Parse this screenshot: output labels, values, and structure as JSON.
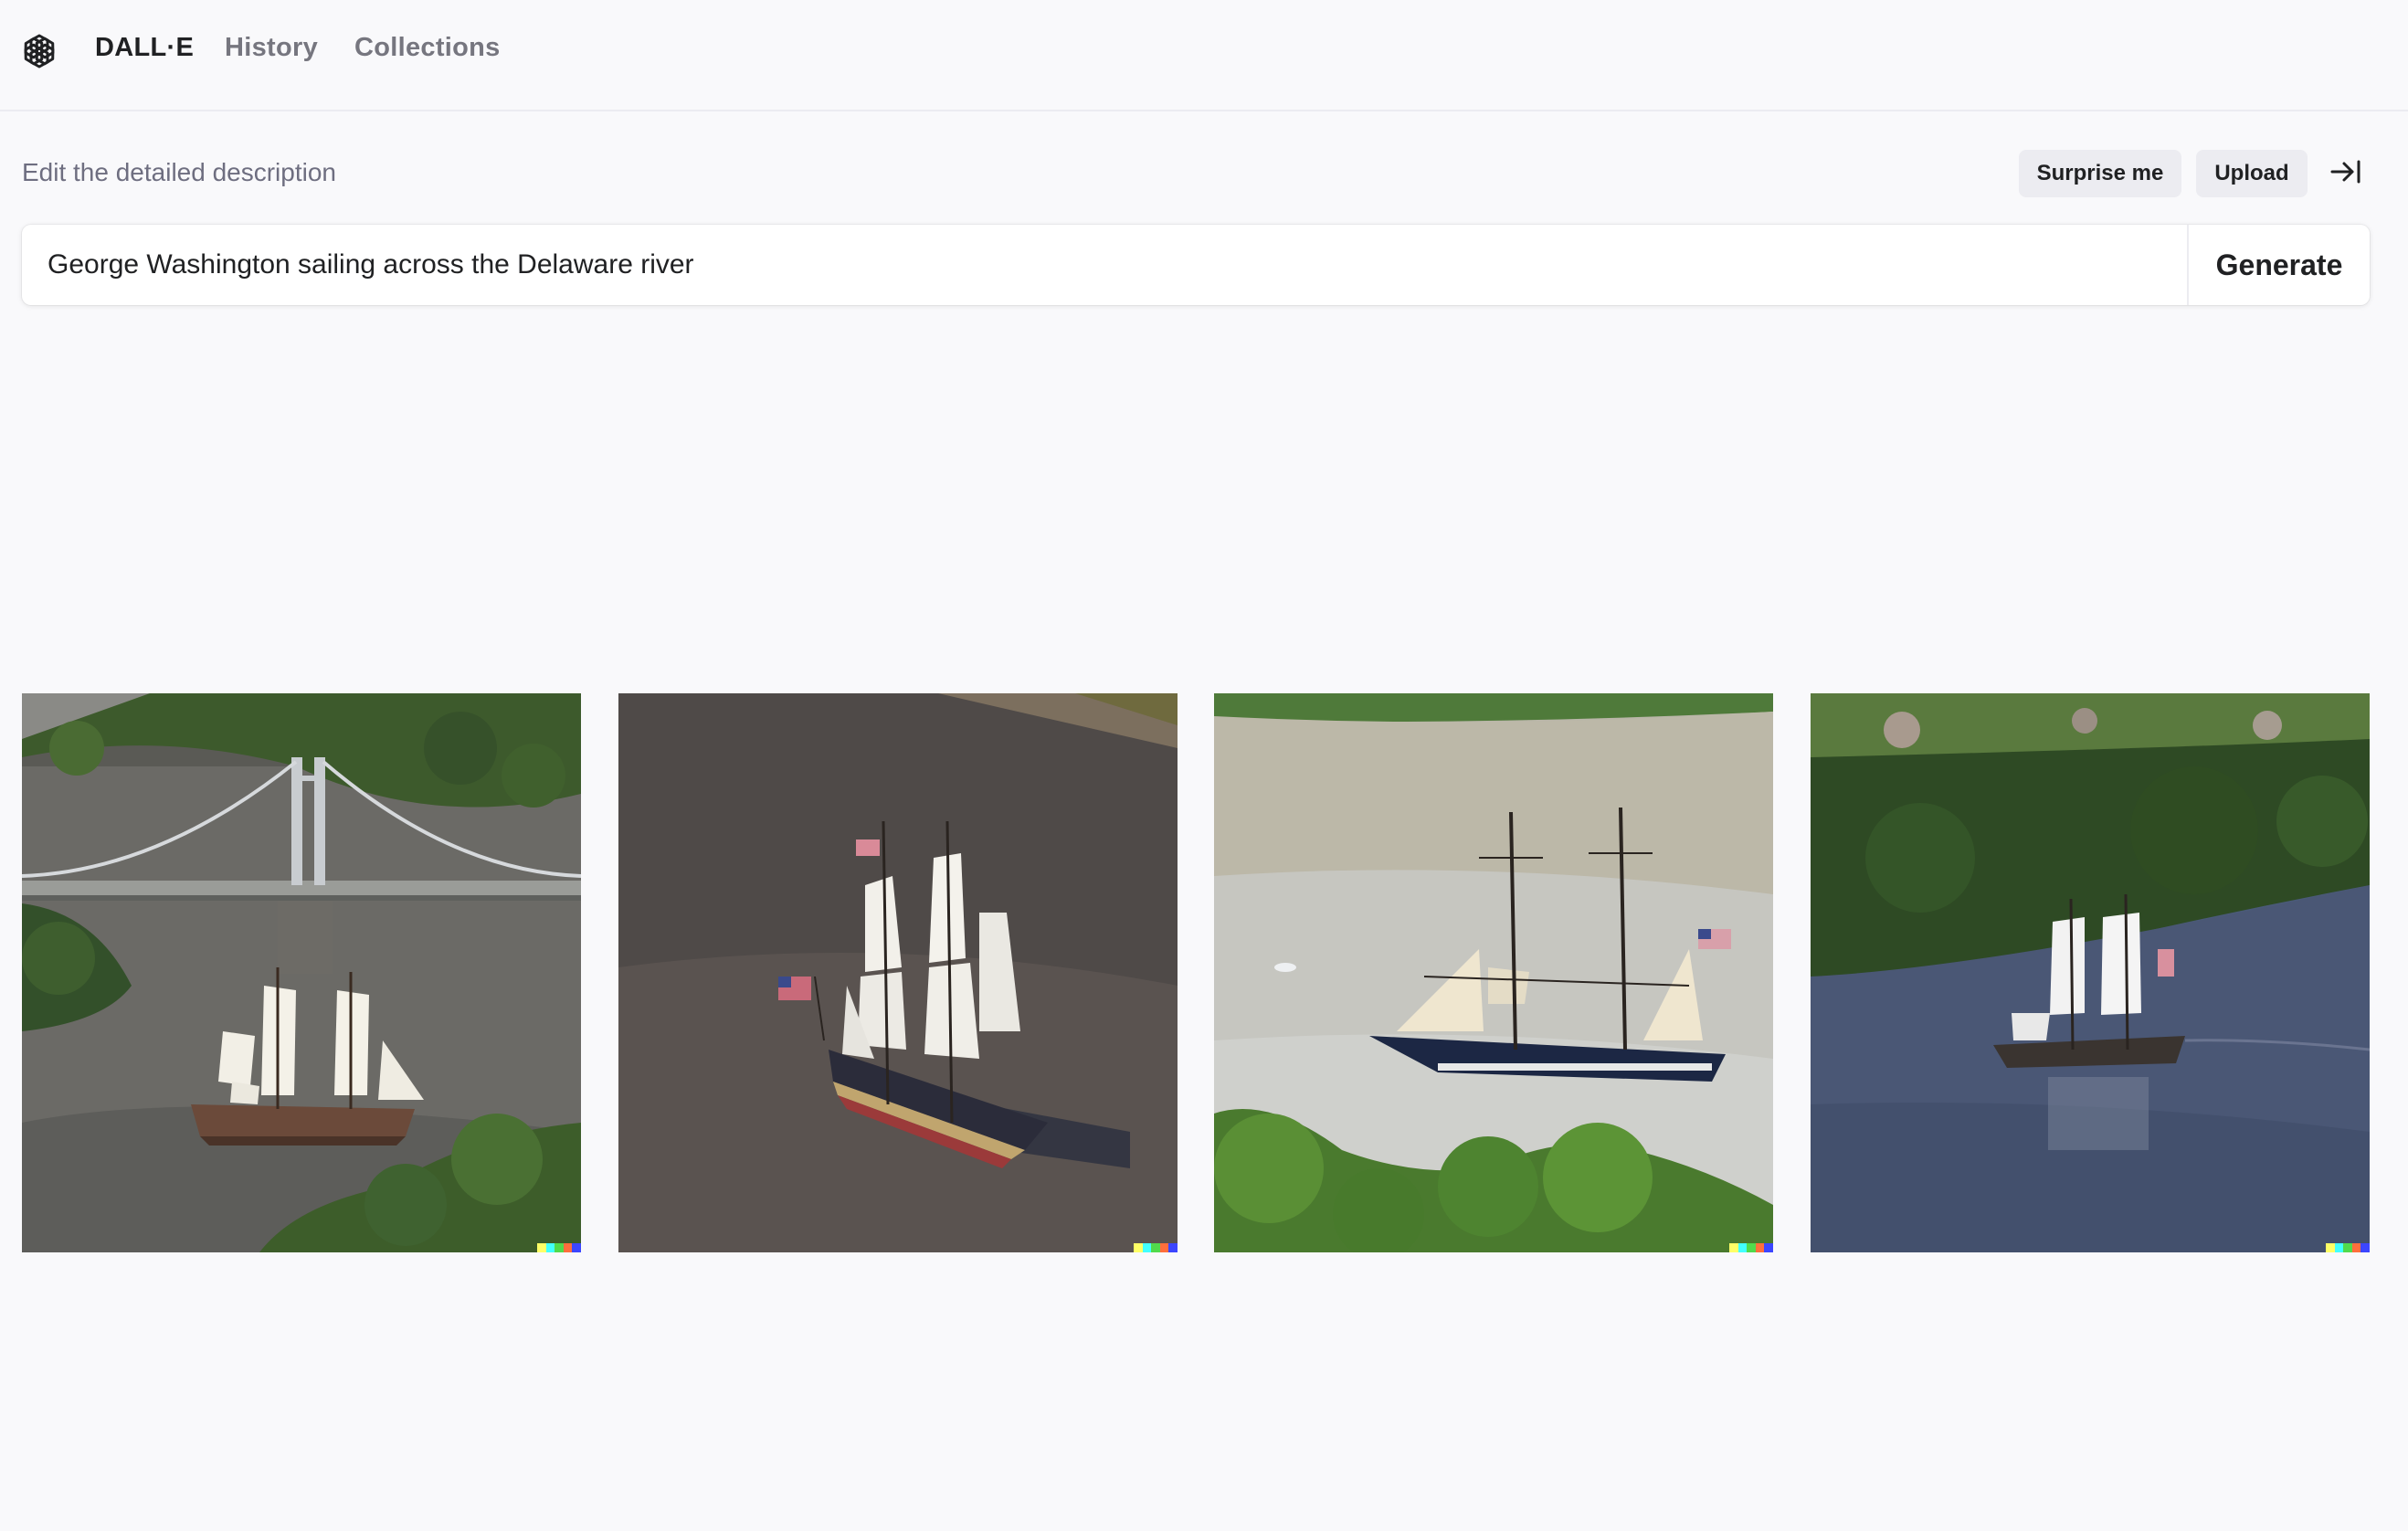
{
  "nav": {
    "brand": "DALL·E",
    "history": "History",
    "collections": "Collections"
  },
  "prompt": {
    "label": "Edit the detailed description",
    "value": "George Washington sailing across the Delaware river",
    "surprise_label": "Surprise me",
    "upload_label": "Upload",
    "generate_label": "Generate"
  },
  "icons": {
    "logo": "openai-logo-icon",
    "collapse": "arrow-right-to-bar-icon"
  },
  "results": [
    {
      "subject": "tall ship under suspension bridge"
    },
    {
      "subject": "tall ship with flags on dark river"
    },
    {
      "subject": "two-masted brig on pale river"
    },
    {
      "subject": "tall ship on river below forested hill"
    }
  ],
  "signature_colors": [
    "#ffff66",
    "#42ffff",
    "#51da4c",
    "#ff6e3c",
    "#3c46ff"
  ],
  "colors": {
    "background": "#f9f9fb",
    "text_primary": "#202123",
    "text_muted": "#76767f",
    "pill_bg": "#ececf1"
  }
}
